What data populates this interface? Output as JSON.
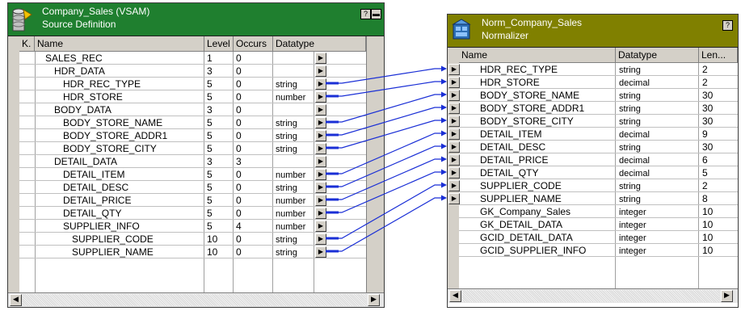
{
  "colors": {
    "source_title_bg": "#1f7f2f",
    "normalizer_title_bg": "#808000",
    "link_color": "#1a2fd6",
    "panel_gray": "#d4d0c8"
  },
  "source": {
    "title_line1": "Company_Sales (VSAM)",
    "title_line2": "Source Definition",
    "help_button": "?",
    "minimize_button": "–",
    "icon": "source-definition-icon",
    "columns": {
      "key": "K.",
      "name": "Name",
      "level": "Level",
      "occurs": "Occurs",
      "datatype": "Datatype"
    },
    "rows": [
      {
        "name": "SALES_REC",
        "level": "1",
        "occurs": "0",
        "datatype": "",
        "indent": 0
      },
      {
        "name": "HDR_DATA",
        "level": "3",
        "occurs": "0",
        "datatype": "",
        "indent": 1
      },
      {
        "name": "HDR_REC_TYPE",
        "level": "5",
        "occurs": "0",
        "datatype": "string",
        "indent": 2
      },
      {
        "name": "HDR_STORE",
        "level": "5",
        "occurs": "0",
        "datatype": "number",
        "indent": 2
      },
      {
        "name": "BODY_DATA",
        "level": "3",
        "occurs": "0",
        "datatype": "",
        "indent": 1
      },
      {
        "name": "BODY_STORE_NAME",
        "level": "5",
        "occurs": "0",
        "datatype": "string",
        "indent": 2
      },
      {
        "name": "BODY_STORE_ADDR1",
        "level": "5",
        "occurs": "0",
        "datatype": "string",
        "indent": 2
      },
      {
        "name": "BODY_STORE_CITY",
        "level": "5",
        "occurs": "0",
        "datatype": "string",
        "indent": 2
      },
      {
        "name": "DETAIL_DATA",
        "level": "3",
        "occurs": "3",
        "datatype": "",
        "indent": 1
      },
      {
        "name": "DETAIL_ITEM",
        "level": "5",
        "occurs": "0",
        "datatype": "number",
        "indent": 2
      },
      {
        "name": "DETAIL_DESC",
        "level": "5",
        "occurs": "0",
        "datatype": "string",
        "indent": 2
      },
      {
        "name": "DETAIL_PRICE",
        "level": "5",
        "occurs": "0",
        "datatype": "number",
        "indent": 2
      },
      {
        "name": "DETAIL_QTY",
        "level": "5",
        "occurs": "0",
        "datatype": "number",
        "indent": 2
      },
      {
        "name": "SUPPLIER_INFO",
        "level": "5",
        "occurs": "4",
        "datatype": "number",
        "indent": 2
      },
      {
        "name": "SUPPLIER_CODE",
        "level": "10",
        "occurs": "0",
        "datatype": "string",
        "indent": 3
      },
      {
        "name": "SUPPLIER_NAME",
        "level": "10",
        "occurs": "0",
        "datatype": "string",
        "indent": 3
      }
    ]
  },
  "normalizer": {
    "title_line1": "Norm_Company_Sales",
    "title_line2": "Normalizer",
    "help_button": "?",
    "icon": "normalizer-icon",
    "columns": {
      "name": "Name",
      "datatype": "Datatype",
      "length": "Len..."
    },
    "rows": [
      {
        "name": "HDR_REC_TYPE",
        "datatype": "string",
        "length": "2",
        "port": true
      },
      {
        "name": "HDR_STORE",
        "datatype": "decimal",
        "length": "2",
        "port": true
      },
      {
        "name": "BODY_STORE_NAME",
        "datatype": "string",
        "length": "30",
        "port": true
      },
      {
        "name": "BODY_STORE_ADDR1",
        "datatype": "string",
        "length": "30",
        "port": true
      },
      {
        "name": "BODY_STORE_CITY",
        "datatype": "string",
        "length": "30",
        "port": true
      },
      {
        "name": "DETAIL_ITEM",
        "datatype": "decimal",
        "length": "9",
        "port": true
      },
      {
        "name": "DETAIL_DESC",
        "datatype": "string",
        "length": "30",
        "port": true
      },
      {
        "name": "DETAIL_PRICE",
        "datatype": "decimal",
        "length": "6",
        "port": true
      },
      {
        "name": "DETAIL_QTY",
        "datatype": "decimal",
        "length": "5",
        "port": true
      },
      {
        "name": "SUPPLIER_CODE",
        "datatype": "string",
        "length": "2",
        "port": true
      },
      {
        "name": "SUPPLIER_NAME",
        "datatype": "string",
        "length": "8",
        "port": true
      },
      {
        "name": "GK_Company_Sales",
        "datatype": "integer",
        "length": "10",
        "port": false
      },
      {
        "name": "GK_DETAIL_DATA",
        "datatype": "integer",
        "length": "10",
        "port": false
      },
      {
        "name": "GCID_DETAIL_DATA",
        "datatype": "integer",
        "length": "10",
        "port": false
      },
      {
        "name": "GCID_SUPPLIER_INFO",
        "datatype": "integer",
        "length": "10",
        "port": false
      }
    ]
  }
}
